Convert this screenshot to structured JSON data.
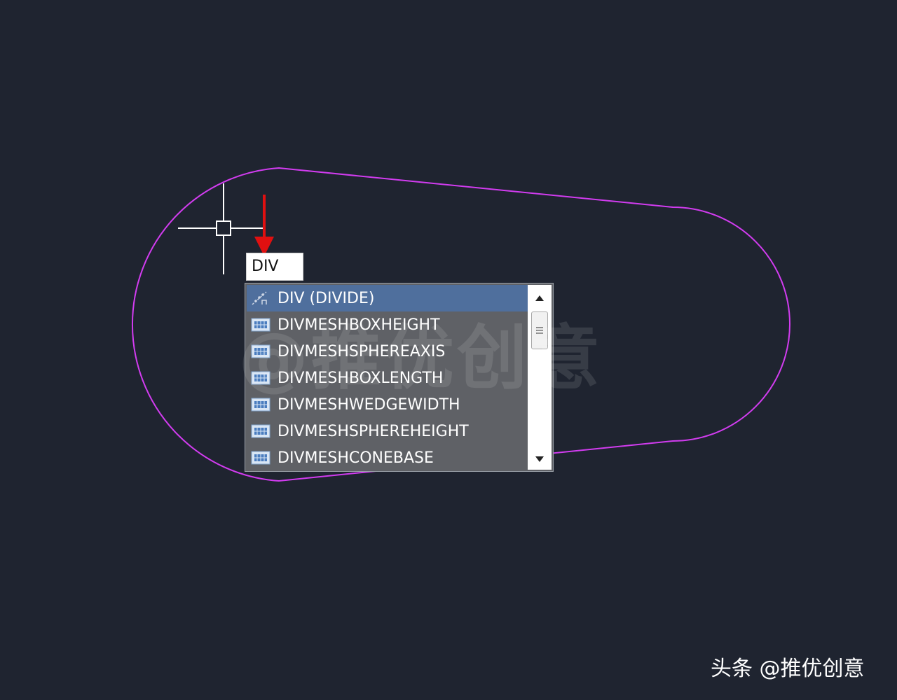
{
  "command_input": {
    "value": "DIV"
  },
  "autocomplete": {
    "items": [
      {
        "label": "DIV (DIVIDE)",
        "icon": "divide-icon",
        "selected": true
      },
      {
        "label": "DIVMESHBOXHEIGHT",
        "icon": "mesh-command-icon",
        "selected": false
      },
      {
        "label": "DIVMESHSPHEREAXIS",
        "icon": "mesh-command-icon",
        "selected": false
      },
      {
        "label": "DIVMESHBOXLENGTH",
        "icon": "mesh-command-icon",
        "selected": false
      },
      {
        "label": "DIVMESHWEDGEWIDTH",
        "icon": "mesh-command-icon",
        "selected": false
      },
      {
        "label": "DIVMESHSPHEREHEIGHT",
        "icon": "mesh-command-icon",
        "selected": false
      },
      {
        "label": "DIVMESHCONEBASE",
        "icon": "mesh-command-icon",
        "selected": false
      }
    ]
  },
  "watermarks": {
    "center": "@推优创意",
    "corner": "头条 @推优创意"
  },
  "colors": {
    "background": "#1f2430",
    "polyline": "#d23cf0",
    "arrow": "#e01010",
    "selection": "#4f6f9d",
    "list_background": "#5f6166"
  }
}
